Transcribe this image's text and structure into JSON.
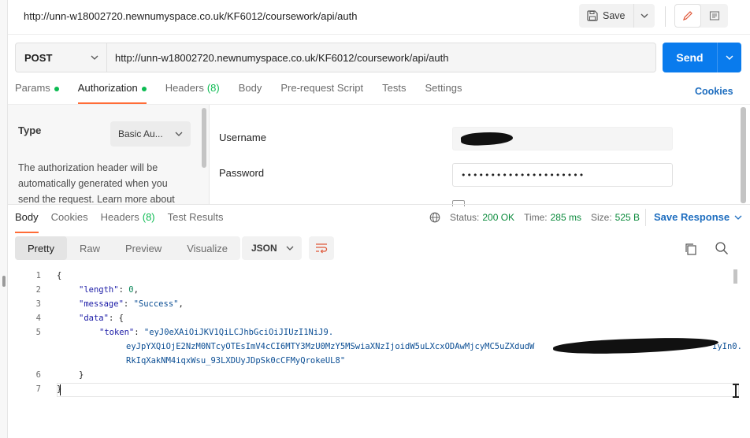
{
  "window": {
    "title_url": "http://unn-w18002720.newnumyspace.co.uk/KF6012/coursework/api/auth",
    "save_label": "Save"
  },
  "request": {
    "method": "POST",
    "url": "http://unn-w18002720.newnumyspace.co.uk/KF6012/coursework/api/auth",
    "send_label": "Send",
    "tabs": [
      {
        "label": "Params",
        "dot": true
      },
      {
        "label": "Authorization",
        "dot": true
      },
      {
        "label": "Headers",
        "count": "(8)"
      },
      {
        "label": "Body"
      },
      {
        "label": "Pre-request Script"
      },
      {
        "label": "Tests"
      },
      {
        "label": "Settings"
      }
    ],
    "cookies_label": "Cookies"
  },
  "auth": {
    "type_label": "Type",
    "type_value": "Basic Au...",
    "description": "The authorization header will be automatically generated when you send the request. Learn more about",
    "username_label": "Username",
    "password_label": "Password",
    "password_value": "•••••••••••••••••••••"
  },
  "response": {
    "tabs": [
      {
        "label": "Body"
      },
      {
        "label": "Cookies"
      },
      {
        "label": "Headers",
        "count": "(8)"
      },
      {
        "label": "Test Results"
      }
    ],
    "status_label": "Status:",
    "status_value": "200 OK",
    "time_label": "Time:",
    "time_value": "285 ms",
    "size_label": "Size:",
    "size_value": "525 B",
    "save_response_label": "Save Response",
    "view_tabs": [
      "Pretty",
      "Raw",
      "Preview",
      "Visualize"
    ],
    "format": "JSON",
    "code": {
      "line_numbers": [
        "1",
        "2",
        "3",
        "4",
        "5",
        "6",
        "7"
      ],
      "open_brace": "{",
      "length_key": "\"length\"",
      "length_value": "0",
      "message_key": "\"message\"",
      "message_value": "\"Success\"",
      "data_key": "\"data\"",
      "token_key": "\"token\"",
      "token_line1": "\"eyJ0eXAiOiJKV1QiLCJhbGciOiJIUzI1NiJ9.",
      "token_line2": "eyJpYXQiOjE2NzM0NTcyOTEsImV4cCI6MTY3MzU0MzY5MSwiaXNzIjoidW5uLXcxODAwMjcyMC5uZXdudW",
      "token_line2_tail": "IyIn0.",
      "token_line3": "RkIqXakNM4iqxWsu_93LXDUyJDpSk0cCFMyQrokeUL8\"",
      "close_inner": "}",
      "close_outer": "}"
    }
  }
}
